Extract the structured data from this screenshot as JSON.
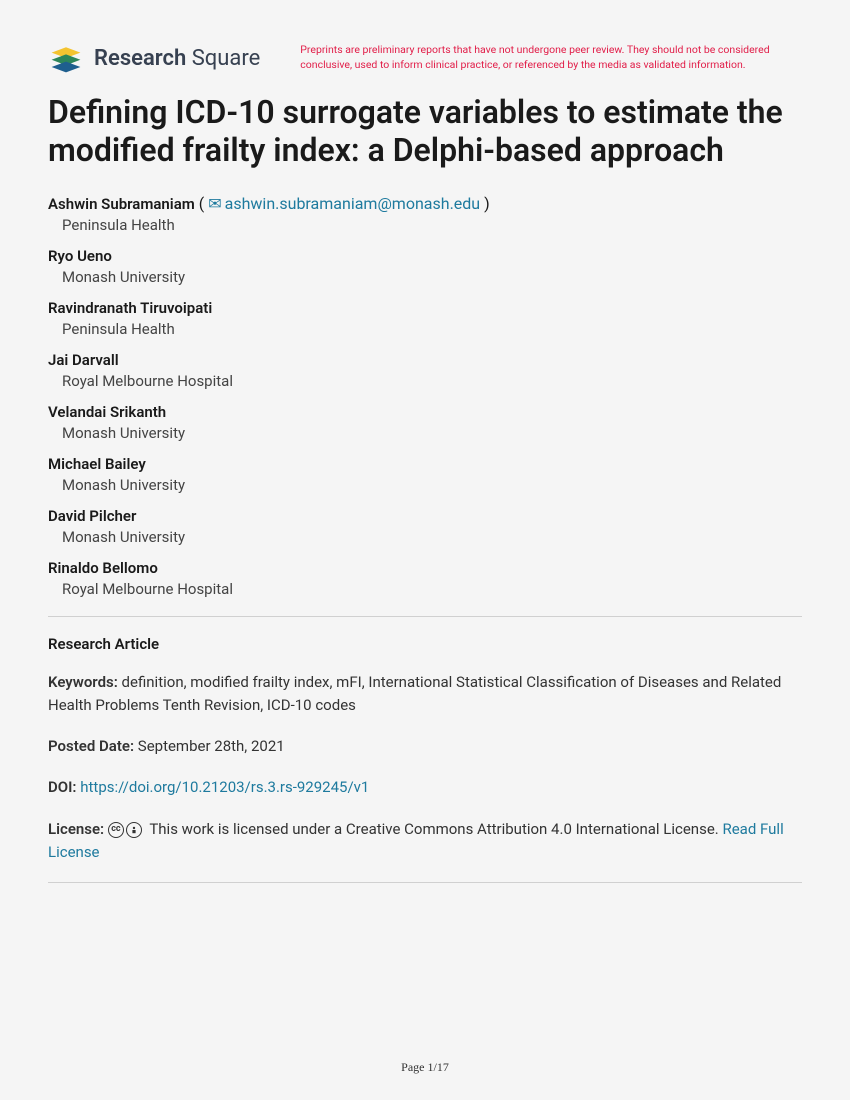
{
  "header": {
    "logo_text_1": "Research",
    "logo_text_2": "Square",
    "disclaimer": "Preprints are preliminary reports that have not undergone peer review. They should not be considered conclusive, used to inform clinical practice, or referenced by the media as validated information."
  },
  "title": "Defining ICD-10 surrogate variables to estimate the modified frailty index: a Delphi-based approach",
  "authors": [
    {
      "name": "Ashwin Subramaniam",
      "email": "ashwin.subramaniam@monash.edu",
      "affiliation": "Peninsula Health"
    },
    {
      "name": "Ryo Ueno",
      "affiliation": "Monash University"
    },
    {
      "name": "Ravindranath Tiruvoipati",
      "affiliation": "Peninsula Health"
    },
    {
      "name": "Jai Darvall",
      "affiliation": "Royal Melbourne Hospital"
    },
    {
      "name": "Velandai Srikanth",
      "affiliation": "Monash University"
    },
    {
      "name": "Michael Bailey",
      "affiliation": "Monash University"
    },
    {
      "name": "David Pilcher",
      "affiliation": "Monash University"
    },
    {
      "name": "Rinaldo Bellomo",
      "affiliation": "Royal Melbourne Hospital"
    }
  ],
  "article_type": "Research Article",
  "meta": {
    "keywords_label": "Keywords:",
    "keywords": "definition, modified frailty index, mFI, International Statistical Classification of Diseases and Related Health Problems Tenth Revision, ICD-10 codes",
    "posted_label": "Posted Date:",
    "posted_date": "September 28th, 2021",
    "doi_label": "DOI:",
    "doi_link": "https://doi.org/10.21203/rs.3.rs-929245/v1",
    "license_label": "License:",
    "license_text": "This work is licensed under a Creative Commons Attribution 4.0 International License.",
    "license_link": "Read Full License"
  },
  "footer": {
    "page": "Page 1/17"
  }
}
